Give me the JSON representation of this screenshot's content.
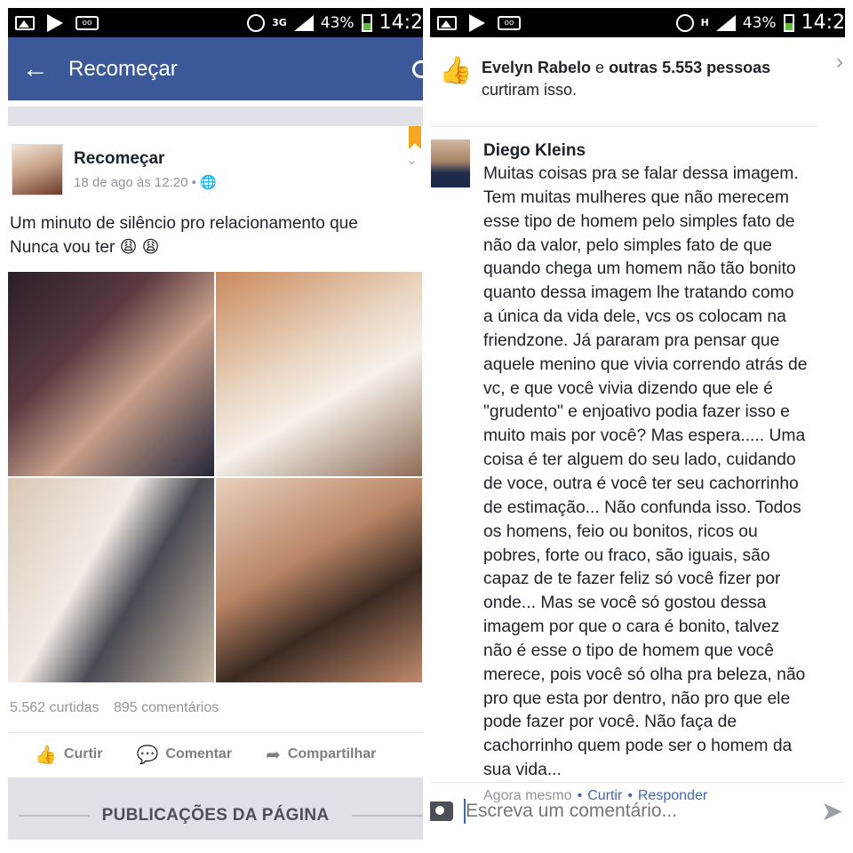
{
  "status_bar_left": {
    "net": "3G",
    "battery": "43%",
    "time": "14:2"
  },
  "status_bar_right": {
    "net": "H",
    "battery": "43%",
    "time": "14:2"
  },
  "header": {
    "title": "Recomeçar"
  },
  "post": {
    "author": "Recomeçar",
    "timestamp": "18 de ago às 12:20 •",
    "text": "Um minuto de silêncio pro relacionamento que\nNunca vou ter 😩 😩",
    "likes": "5.562 curtidas",
    "comments_count": "895 comentários",
    "actions": {
      "like": "Curtir",
      "comment": "Comentar",
      "share": "Compartilhar"
    },
    "page_posts_label": "PUBLICAÇÕES DA PÁGINA"
  },
  "likers": {
    "names": "Evelyn Rabelo",
    "connector": " e ",
    "others": "outras 5.553 pessoas",
    "suffix": "curtiram isso."
  },
  "comment": {
    "author": "Diego Kleins",
    "text": "Muitas coisas pra se falar dessa imagem.\nTem muitas mulheres que não merecem\nesse tipo de homem pelo simples fato de\nnão da valor, pelo simples fato de que\nquando chega um homem não tão bonito\nquanto dessa imagem lhe tratando como\na única da vida dele, vcs os colocam na\nfriendzone. Já pararam pra pensar que\naquele menino que vivia correndo atrás de\nvc, e que você vivia dizendo que ele é\n\"grudento\" e enjoativo podia fazer isso e\nmuito mais por você? Mas espera..... Uma\ncoisa é ter alguem do seu lado, cuidando\nde voce, outra é você ter seu cachorrinho\nde estimação... Não confunda isso. Todos\nos homens, feio ou bonitos, ricos ou\npobres, forte ou fraco, são iguais, são\ncapaz de te fazer feliz só você fizer por\nonde... Mas se você só gostou dessa\nimagem por que o cara é bonito, talvez\nnão é esse o tipo de homem que você\nmerece, pois você só olha pra beleza, não\npro que esta por dentro, não pro que ele\npode fazer por você. Não faça de\ncachorrinho quem pode ser o homem da\nsua vida...",
    "time": "Agora mesmo",
    "like": "Curtir",
    "reply": "Responder"
  },
  "composer": {
    "placeholder": "Escreva um comentário..."
  }
}
